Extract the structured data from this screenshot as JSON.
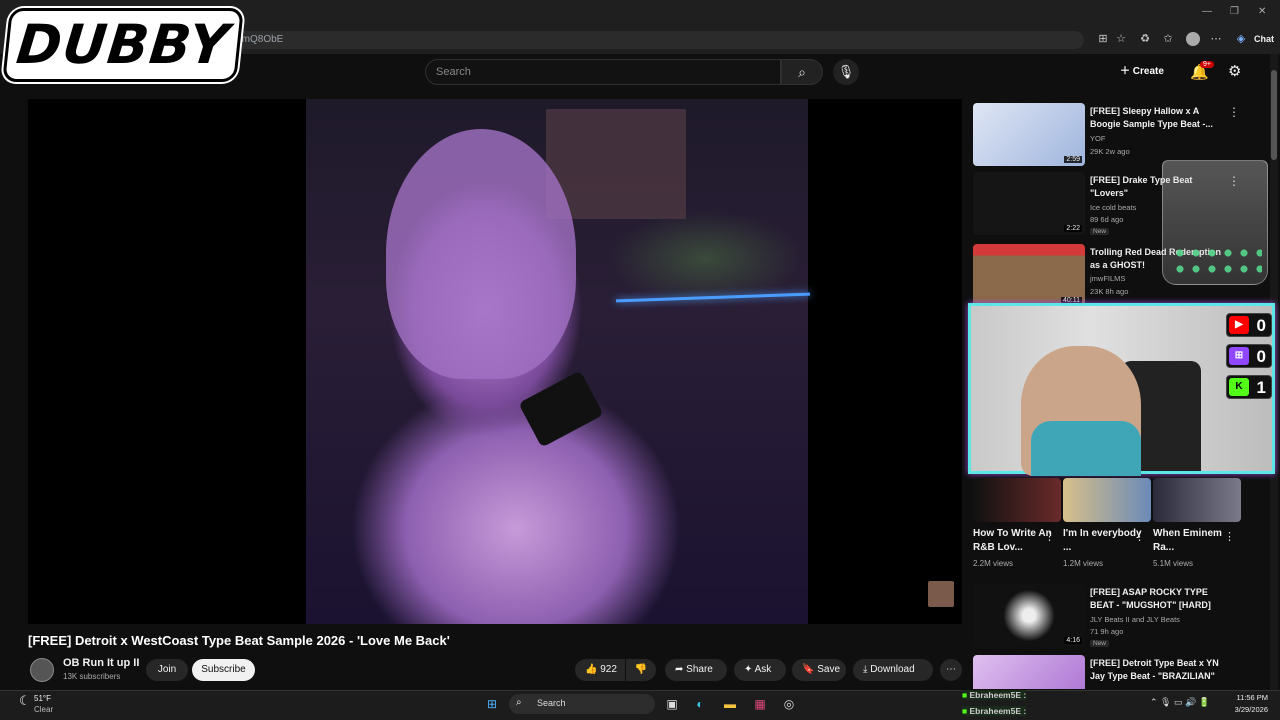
{
  "browser": {
    "address": "JPmQ8ObE",
    "chat_label": "Chat",
    "icons": [
      "split-view-icon",
      "favorite-icon",
      "extensions-icon",
      "favorites-bar-icon",
      "profile-icon",
      "menu-icon",
      "copilot-icon"
    ]
  },
  "overlay": {
    "logo_text": "DUBBY"
  },
  "youtube": {
    "search_placeholder": "Search",
    "create_label": "Create",
    "notification_count": "9+"
  },
  "video": {
    "title": "[FREE] Detroit x WestCoast Type Beat Sample 2026 - 'Love Me Back'",
    "channel": "OB Run It up II",
    "subscribers": "13K subscribers",
    "join": "Join",
    "subscribe": "Subscribe",
    "likes": "922",
    "share": "Share",
    "ask": "Ask",
    "save": "Save",
    "download": "Download"
  },
  "recommendations": [
    {
      "title": "[FREE] Sleepy Hallow x A Boogie Sample Type Beat -...",
      "channel": "YOF",
      "meta": "29K  2w ago",
      "duration": "2:59",
      "thumb": "#c9d7f0",
      "new": ""
    },
    {
      "title": "[FREE] Drake Type Beat \"Lovers\"",
      "channel": "Ice cold beats",
      "meta": "89  6d ago",
      "duration": "2:22",
      "thumb": "#1a1a1a",
      "new": "New"
    },
    {
      "title": "Trolling Red Dead Redemption as a GHOST!",
      "channel": "jmwFILMS",
      "meta": "23K  8h ago",
      "duration": "40:11",
      "thumb": "#8a6a4a",
      "new": ""
    },
    {
      "title": "[FREE] ASAP ROCKY TYPE BEAT - \"MUGSHOT\" [HARD]",
      "channel": "JLY Beats II and JLY Beats",
      "meta": "71  9h ago",
      "duration": "4:16",
      "thumb": "#111111",
      "new": "New"
    },
    {
      "title": "[FREE] Detroit Type Beat x YN Jay Type Beat - \"BRAZILIAN\"",
      "channel": "",
      "meta": "",
      "duration": "",
      "thumb": "#c79ad9",
      "new": ""
    }
  ],
  "shorts": [
    {
      "title": "How To Write An R&B Lov...",
      "views": "2.2M views",
      "thumb": "#6a2a2a"
    },
    {
      "title": "I'm In everybody ...",
      "views": "1.2M views",
      "thumb": "#b89a6a"
    },
    {
      "title": "When Eminem Ra...",
      "views": "5.1M views",
      "thumb": "#4a4a5a"
    }
  ],
  "stream_counters": [
    {
      "platform": "youtube",
      "value": "0",
      "color": "#ff0000",
      "glyph": "▶"
    },
    {
      "platform": "twitch",
      "value": "0",
      "color": "#9146ff",
      "glyph": "⊞"
    },
    {
      "platform": "kick",
      "value": "1",
      "color": "#53fc18",
      "glyph": "K"
    }
  ],
  "chat_lines": [
    {
      "user": "Ebraheem5E",
      "text": ":"
    },
    {
      "user": "Ebraheem5E",
      "text": ":"
    }
  ],
  "taskbar": {
    "temperature": "51°F",
    "condition": "Clear",
    "search": "Search",
    "time": "11:56 PM",
    "date": "3/29/2026"
  }
}
